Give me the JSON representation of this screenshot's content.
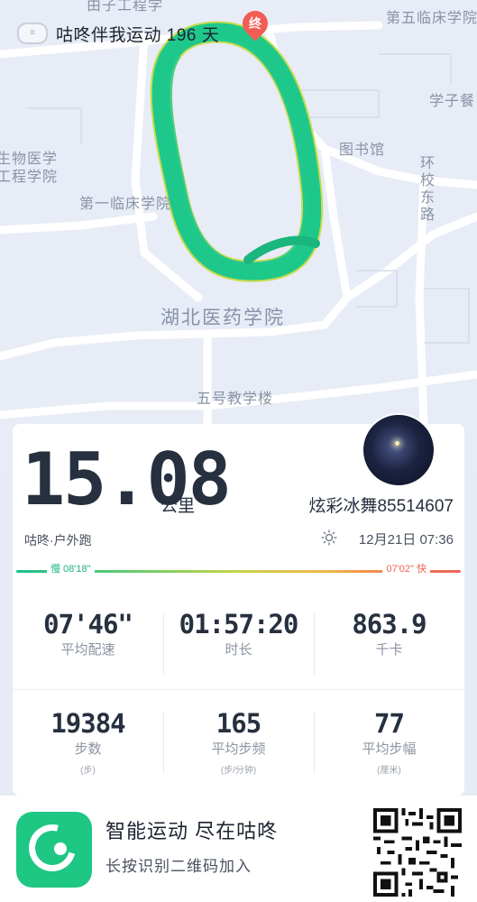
{
  "header": {
    "title": "咕咚伴我运动 196 天",
    "left_icon": "app-badge-icon"
  },
  "map": {
    "labels": {
      "top_right": "第五临床学院",
      "top_left": "由子工程学",
      "right_mid": "学子餐",
      "bio_1": "生物医学",
      "bio_2": "工程学院",
      "library": "图书馆",
      "road": "环校东路",
      "first_clinical": "第一临床学院",
      "campus": "湖北医药学院",
      "teaching_building": "五号教学楼"
    },
    "end_marker": "终",
    "route_color": "#1ec88a"
  },
  "summary": {
    "distance": "15.08",
    "distance_unit": "公里",
    "username": "炫彩冰舞85514607",
    "sport_type": "咕咚·户外跑",
    "datetime": "12月21日 07:36",
    "weather_icon": "sun-icon"
  },
  "pace_bar": {
    "slow_label": "慢 08'18\"",
    "fast_label": "07'02\" 快"
  },
  "stats_top": [
    {
      "value": "07'46\"",
      "label": "平均配速"
    },
    {
      "value": "01:57:20",
      "label": "时长"
    },
    {
      "value": "863.9",
      "label": "千卡"
    }
  ],
  "stats_bottom": [
    {
      "value": "19384",
      "label": "步数",
      "unit": "(步)"
    },
    {
      "value": "165",
      "label": "平均步频",
      "unit": "(步/分钟)"
    },
    {
      "value": "77",
      "label": "平均步幅",
      "unit": "(厘米)"
    }
  ],
  "footer": {
    "title": "智能运动 尽在咕咚",
    "subtitle": "长按识别二维码加入",
    "logo_icon": "codoon-logo-icon",
    "qr_icon": "qr-code-icon"
  },
  "colors": {
    "accent_green": "#1ec783",
    "fast_red": "#ef6252",
    "text_dark": "#27303f"
  }
}
